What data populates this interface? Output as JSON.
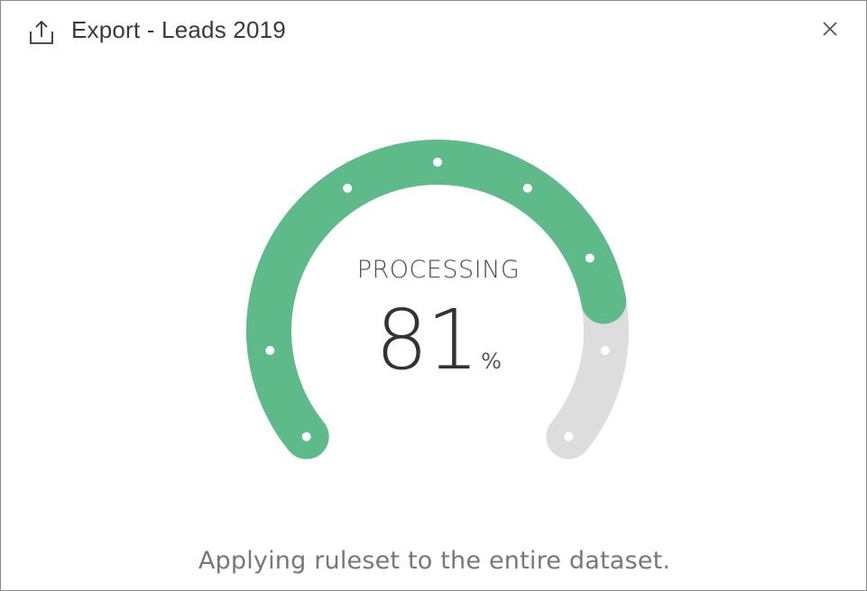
{
  "dialog": {
    "title": "Export - Leads 2019",
    "header_icon": "export-upload-icon",
    "close_icon": "close-icon"
  },
  "progress": {
    "status": "PROCESSING",
    "value": "81",
    "unit": "%",
    "fraction": 0.81,
    "segments": 8
  },
  "footer": {
    "message": "Applying ruleset to the entire dataset."
  },
  "colors": {
    "progress_fill": "#5fba8a",
    "track": "#dddddd",
    "tick_dot": "#ffffff"
  }
}
